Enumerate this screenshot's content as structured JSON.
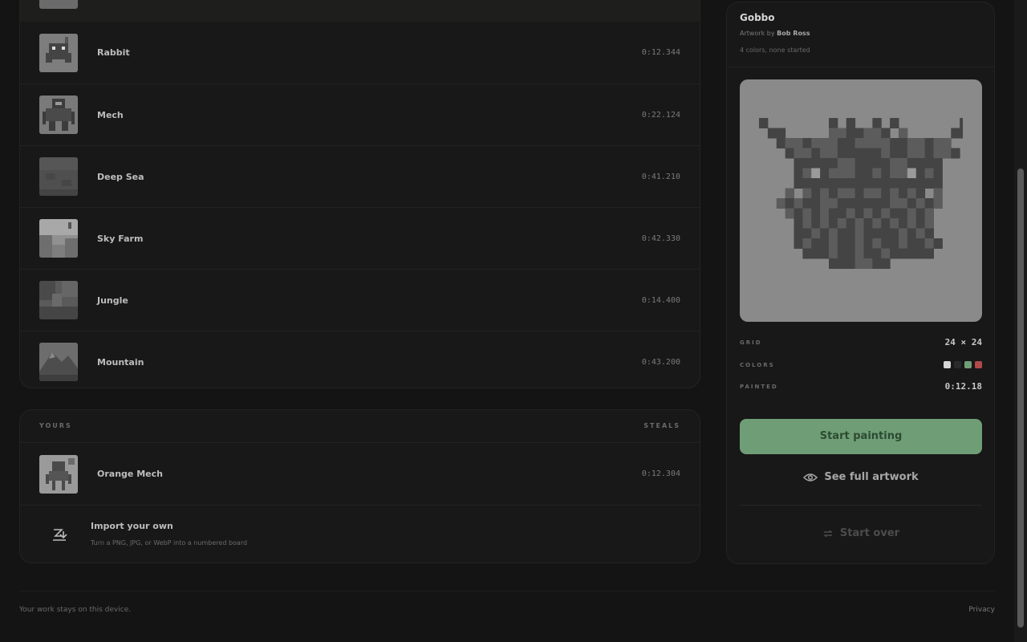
{
  "list": {
    "rows": [
      {
        "name": "Rabbit",
        "time": "0:12.344",
        "thumb_icon": "rabbit-icon"
      },
      {
        "name": "Mech",
        "time": "0:22.124",
        "thumb_icon": "mech-icon"
      },
      {
        "name": "Deep Sea",
        "time": "0:41.210",
        "thumb_icon": "deep-sea-icon"
      },
      {
        "name": "Sky Farm",
        "time": "0:42.330",
        "thumb_icon": "sky-farm-icon"
      },
      {
        "name": "Jungle",
        "time": "0:14.400",
        "thumb_icon": "jungle-icon"
      },
      {
        "name": "Mountain",
        "time": "0:43.200",
        "thumb_icon": "mountain-icon"
      }
    ]
  },
  "yours": {
    "header_left": "YOURS",
    "header_right": "STEALS",
    "rows": [
      {
        "name": "Orange Mech",
        "time": "0:12.304",
        "thumb_icon": "orange-mech-icon"
      }
    ],
    "import": {
      "title": "Import your own",
      "subtitle": "Turn a PNG, JPG, or WebP into a numbered board"
    }
  },
  "side": {
    "title": "Gobbo",
    "author_prefix": "Artwork by",
    "author": "Bob Ross",
    "meta": "4 colors, none started",
    "grid_label": "GRID",
    "grid_value": "24 × 24",
    "colors_label": "COLORS",
    "colors": [
      "#d6d6d6",
      "#2a2a2a",
      "#6f9e76",
      "#b24a4a"
    ],
    "painted_label": "PAINTED",
    "painted_value": "0:12.18",
    "start_button": "Start painting",
    "see_full": "See full artwork",
    "start_over": "Start over"
  },
  "footer": {
    "left": "Your work stays on this device.",
    "right": "Privacy"
  }
}
